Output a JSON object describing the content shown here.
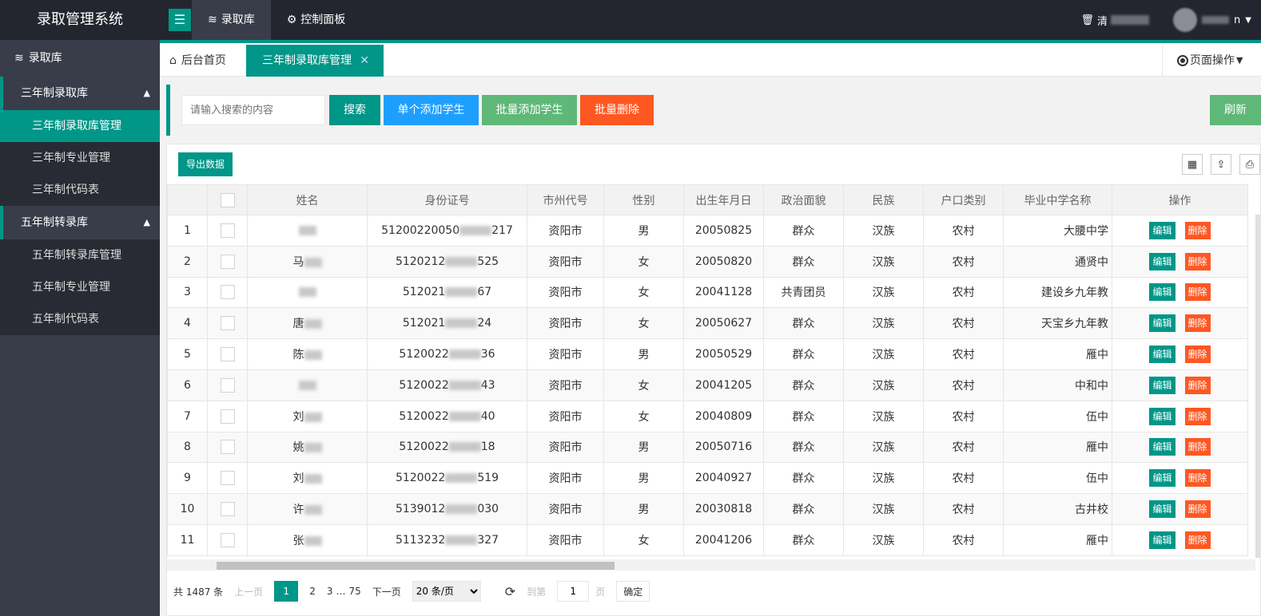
{
  "app": {
    "title": "录取管理系统"
  },
  "header": {
    "nav": [
      {
        "label": "录取库",
        "icon": "layers-icon"
      },
      {
        "label": "控制面板",
        "icon": "gear-icon"
      }
    ],
    "clear_cache_label": "清",
    "user_suffix": "n"
  },
  "sidebar": {
    "head": "录取库",
    "groups": [
      {
        "title": "三年制录取库",
        "items": [
          "三年制录取库管理",
          "三年制专业管理",
          "三年制代码表"
        ]
      },
      {
        "title": "五年制转录库",
        "items": [
          "五年制转录库管理",
          "五年制专业管理",
          "五年制代码表"
        ]
      }
    ]
  },
  "tabs": {
    "home": "后台首页",
    "current": "三年制录取库管理",
    "page_ops": "页面操作"
  },
  "search": {
    "placeholder": "请输入搜索的内容",
    "search_btn": "搜索",
    "single_add": "单个添加学生",
    "batch_add": "批量添加学生",
    "batch_delete": "批量删除",
    "refresh": "刷新"
  },
  "table": {
    "export": "导出数据",
    "columns": [
      "",
      "",
      "姓名",
      "身份证号",
      "市州代号",
      "性别",
      "出生年月日",
      "政治面貌",
      "民族",
      "户口类别",
      "毕业中学名称",
      "操作"
    ],
    "edit_label": "编辑",
    "delete_label": "删除",
    "rows": [
      {
        "no": "1",
        "name": "",
        "id_a": "51200220050",
        "id_b": "217",
        "city": "资阳市",
        "gender": "男",
        "birth": "20050825",
        "party": "群众",
        "nation": "汉族",
        "hukou": "农村",
        "school": "大腰中学"
      },
      {
        "no": "2",
        "name": "马",
        "id_a": "5120212",
        "id_b": "525",
        "city": "资阳市",
        "gender": "女",
        "birth": "20050820",
        "party": "群众",
        "nation": "汉族",
        "hukou": "农村",
        "school": "通贤中"
      },
      {
        "no": "3",
        "name": "",
        "id_a": "512021",
        "id_b": "67",
        "city": "资阳市",
        "gender": "女",
        "birth": "20041128",
        "party": "共青团员",
        "nation": "汉族",
        "hukou": "农村",
        "school": "建设乡九年教"
      },
      {
        "no": "4",
        "name": "唐",
        "id_a": "512021",
        "id_b": "24",
        "city": "资阳市",
        "gender": "女",
        "birth": "20050627",
        "party": "群众",
        "nation": "汉族",
        "hukou": "农村",
        "school": "天宝乡九年教"
      },
      {
        "no": "5",
        "name": "陈",
        "id_a": "5120022",
        "id_b": "36",
        "city": "资阳市",
        "gender": "男",
        "birth": "20050529",
        "party": "群众",
        "nation": "汉族",
        "hukou": "农村",
        "school": "雁中"
      },
      {
        "no": "6",
        "name": "",
        "id_a": "5120022",
        "id_b": "43",
        "city": "资阳市",
        "gender": "女",
        "birth": "20041205",
        "party": "群众",
        "nation": "汉族",
        "hukou": "农村",
        "school": "中和中"
      },
      {
        "no": "7",
        "name": "刘",
        "id_a": "5120022",
        "id_b": "40",
        "city": "资阳市",
        "gender": "女",
        "birth": "20040809",
        "party": "群众",
        "nation": "汉族",
        "hukou": "农村",
        "school": "伍中"
      },
      {
        "no": "8",
        "name": "姚",
        "id_a": "5120022",
        "id_b": "18",
        "city": "资阳市",
        "gender": "男",
        "birth": "20050716",
        "party": "群众",
        "nation": "汉族",
        "hukou": "农村",
        "school": "雁中"
      },
      {
        "no": "9",
        "name": "刘",
        "id_a": "5120022",
        "id_b": "519",
        "city": "资阳市",
        "gender": "男",
        "birth": "20040927",
        "party": "群众",
        "nation": "汉族",
        "hukou": "农村",
        "school": "伍中"
      },
      {
        "no": "10",
        "name": "许",
        "id_a": "5139012",
        "id_b": "030",
        "city": "资阳市",
        "gender": "男",
        "birth": "20030818",
        "party": "群众",
        "nation": "汉族",
        "hukou": "农村",
        "school": "古井校"
      },
      {
        "no": "11",
        "name": "张",
        "id_a": "5113232",
        "id_b": "327",
        "city": "资阳市",
        "gender": "女",
        "birth": "20041206",
        "party": "群众",
        "nation": "汉族",
        "hukou": "农村",
        "school": "雁中"
      }
    ]
  },
  "pager": {
    "total": "共 1487 条",
    "prev": "上一页",
    "pages": [
      "1",
      "2",
      "3"
    ],
    "ellipsis": "…",
    "last": "75",
    "next": "下一页",
    "page_size": "20 条/页",
    "goto": "到第",
    "goto_value": "1",
    "page_unit": "页",
    "confirm": "确定"
  },
  "colors": {
    "teal": "#009688",
    "blue": "#1e9fff",
    "green": "#5fb878",
    "orange": "#ff5722",
    "dark": "#23262e",
    "sidebar": "#393d49"
  }
}
